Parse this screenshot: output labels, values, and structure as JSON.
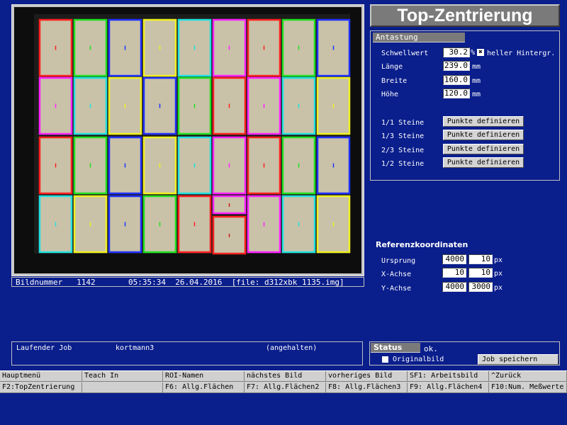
{
  "title": "Top-Zentrierung",
  "image_status": {
    "label": "Bildnummer",
    "number": "1142",
    "time": "05:35:34",
    "date": "26.04.2016",
    "file": "[file: d312xbk_1135.img]"
  },
  "antastung": {
    "header": "Antastung",
    "schwellwert_label": "Schwellwert",
    "schwellwert_value": "30.2",
    "schwellwert_unit": "%",
    "heller_checked": true,
    "heller_label": "heller Hintergr.",
    "laenge_label": "Länge",
    "laenge_value": "239.0",
    "breite_label": "Breite",
    "breite_value": "160.0",
    "hoehe_label": "Höhe",
    "hoehe_value": "120.0",
    "unit_mm": "mm",
    "steine": [
      {
        "label": "1/1 Steine",
        "button": "Punkte definieren"
      },
      {
        "label": "1/3 Steine",
        "button": "Punkte definieren"
      },
      {
        "label": "2/3 Steine",
        "button": "Punkte definieren"
      },
      {
        "label": "1/2 Steine",
        "button": "Punkte definieren"
      }
    ]
  },
  "referenz": {
    "title": "Referenzkoordinaten",
    "unit": "px",
    "rows": [
      {
        "label": "Ursprung",
        "v1": "4000",
        "v2": "10"
      },
      {
        "label": "X-Achse",
        "v1": "10",
        "v2": "10"
      },
      {
        "label": "Y-Achse",
        "v1": "4000",
        "v2": "3000"
      }
    ]
  },
  "job": {
    "label": "Laufender Job",
    "name": "kortmann3",
    "state": "(angehalten)"
  },
  "status": {
    "header": "Status",
    "value": "ok.",
    "originalbild_checked": false,
    "originalbild_label": "Originalbild",
    "save_button": "Job speichern"
  },
  "fkeys": {
    "row1": [
      "Hauptmenü",
      "Teach In",
      "ROI-Namen",
      "nächstes Bild",
      "vorheriges Bild",
      "SF1: Arbeitsbild",
      "^Zurück"
    ],
    "row2": [
      "F2:TopZentrierung",
      "",
      "F6: Allg.Flächen",
      "F7: Allg.Flächen2",
      "F8: Allg.Flächen3",
      "F9: Allg.Flächen4",
      "F10:Num. Meßwerte"
    ]
  },
  "colors": {
    "background": "#0a1e8c",
    "brick_fill": "#c9c2a8",
    "outline_red": "#ff2020",
    "outline_green": "#20e020",
    "outline_blue": "#2030ff",
    "outline_yellow": "#f0f020",
    "outline_cyan": "#20e0e0",
    "outline_magenta": "#ff20ff"
  },
  "bricks": {
    "rows": [
      [
        "red",
        "green",
        "blue",
        "yellow",
        "cyan",
        "magenta",
        "red",
        "green",
        "blue"
      ],
      [
        "magenta",
        "cyan",
        "yellow",
        "blue",
        "green",
        "red",
        "magenta",
        "cyan",
        "yellow"
      ],
      [
        "red",
        "green",
        "blue",
        "yellow",
        "cyan",
        "magenta",
        "red",
        "green",
        "blue"
      ],
      [
        "cyan",
        "yellow",
        "blue",
        "green",
        "red",
        "magenta",
        "magenta",
        "cyan",
        "yellow"
      ]
    ],
    "split_column": {
      "row": 3,
      "col": 5,
      "top_color": "magenta",
      "bottom_color": "red"
    }
  }
}
